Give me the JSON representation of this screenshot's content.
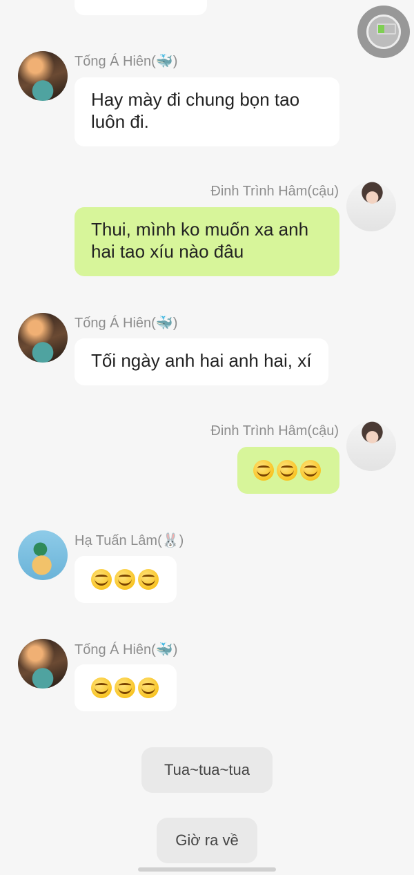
{
  "messages": [
    {
      "name": "Tống Á Hiên(🐳)",
      "text": "Hay mày đi chung bọn tao luôn đi."
    },
    {
      "name": "Đinh Trình Hâm(cậu)",
      "text": "Thui, mình ko muốn xa anh hai tao xíu nào đâu"
    },
    {
      "name": "Tống Á Hiên(🐳)",
      "text": "Tối ngày anh hai anh hai, xí"
    },
    {
      "name": "Đinh Trình Hâm(cậu)",
      "emoji": "laughing-emoji x3"
    },
    {
      "name": "Hạ Tuấn Lâm(🐰)",
      "emoji": "laughing-emoji x3"
    },
    {
      "name": "Tống Á Hiên(🐳)",
      "emoji": "laughing-emoji x3"
    }
  ],
  "quick_replies": [
    "Tua~tua~tua",
    "Giờ ra về"
  ],
  "colors": {
    "right_bubble": "#d7f59a",
    "left_bubble": "#ffffff",
    "background": "#f6f6f6"
  }
}
